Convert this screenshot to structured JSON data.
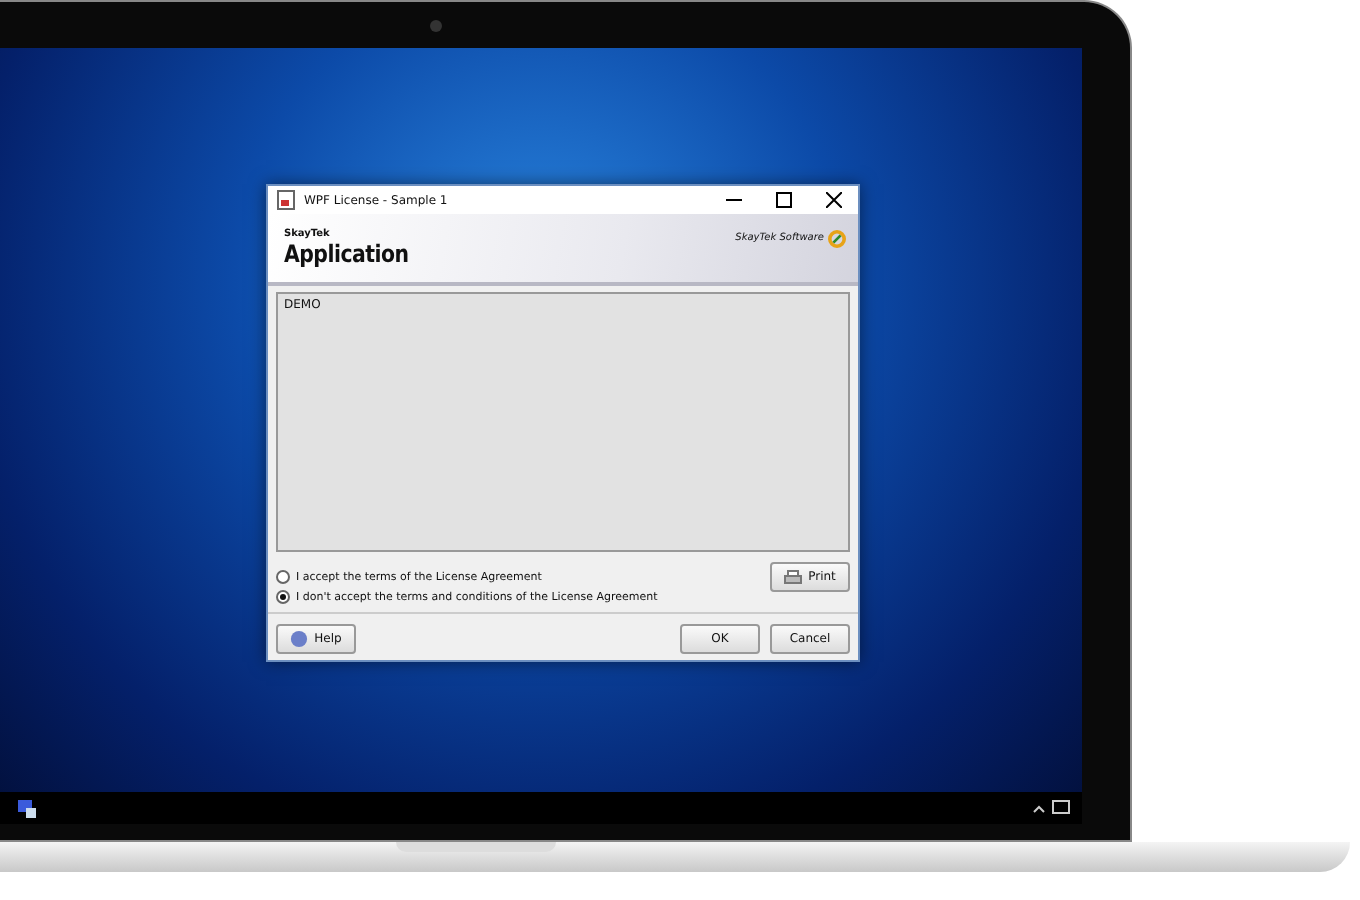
{
  "window": {
    "title": "WPF License - Sample 1"
  },
  "header": {
    "brand": "SkayTek",
    "title": "Application",
    "vendor": "SkayTek Software"
  },
  "license_text": "DEMO",
  "options": [
    {
      "label": "I accept the terms of the License Agreement",
      "selected": false
    },
    {
      "label": "I don't accept the terms and conditions of the License Agreement",
      "selected": true
    }
  ],
  "print_button": "Print",
  "help_button": "Help",
  "buttons": [
    "OK",
    "Cancel"
  ]
}
